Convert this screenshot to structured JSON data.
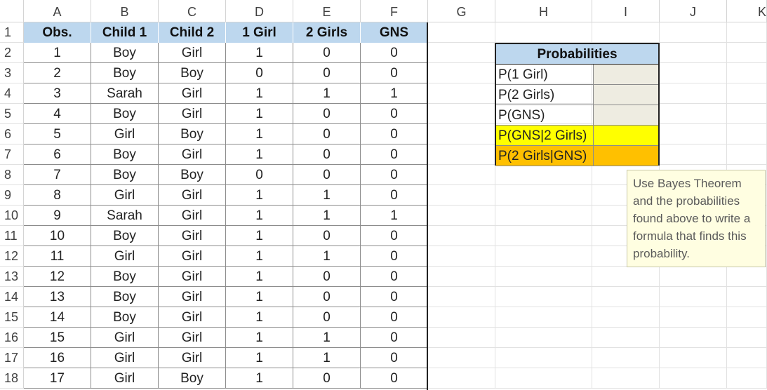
{
  "columns": [
    "A",
    "B",
    "C",
    "D",
    "E",
    "F",
    "G",
    "H",
    "I",
    "J",
    "K"
  ],
  "rows": [
    "1",
    "2",
    "3",
    "4",
    "5",
    "6",
    "7",
    "8",
    "9",
    "10",
    "11",
    "12",
    "13",
    "14",
    "15",
    "16",
    "17",
    "18"
  ],
  "table": {
    "headers": [
      "Obs.",
      "Child 1",
      "Child 2",
      "1 Girl",
      "2 Girls",
      "GNS"
    ],
    "data": [
      [
        "1",
        "Boy",
        "Girl",
        "1",
        "0",
        "0"
      ],
      [
        "2",
        "Boy",
        "Boy",
        "0",
        "0",
        "0"
      ],
      [
        "3",
        "Sarah",
        "Girl",
        "1",
        "1",
        "1"
      ],
      [
        "4",
        "Boy",
        "Girl",
        "1",
        "0",
        "0"
      ],
      [
        "5",
        "Girl",
        "Boy",
        "1",
        "0",
        "0"
      ],
      [
        "6",
        "Boy",
        "Girl",
        "1",
        "0",
        "0"
      ],
      [
        "7",
        "Boy",
        "Boy",
        "0",
        "0",
        "0"
      ],
      [
        "8",
        "Girl",
        "Girl",
        "1",
        "1",
        "0"
      ],
      [
        "9",
        "Sarah",
        "Girl",
        "1",
        "1",
        "1"
      ],
      [
        "10",
        "Boy",
        "Girl",
        "1",
        "0",
        "0"
      ],
      [
        "11",
        "Girl",
        "Girl",
        "1",
        "1",
        "0"
      ],
      [
        "12",
        "Boy",
        "Girl",
        "1",
        "0",
        "0"
      ],
      [
        "13",
        "Boy",
        "Girl",
        "1",
        "0",
        "0"
      ],
      [
        "14",
        "Boy",
        "Girl",
        "1",
        "0",
        "0"
      ],
      [
        "15",
        "Girl",
        "Girl",
        "1",
        "1",
        "0"
      ],
      [
        "16",
        "Girl",
        "Girl",
        "1",
        "1",
        "0"
      ],
      [
        "17",
        "Girl",
        "Boy",
        "1",
        "0",
        "0"
      ]
    ]
  },
  "probabilities": {
    "title": "Probabilities",
    "items": [
      {
        "label": "P(1 Girl)",
        "value": "",
        "color": "#eeece1"
      },
      {
        "label": "P(2 Girls)",
        "value": "",
        "color": "#eeece1"
      },
      {
        "label": "P(GNS)",
        "value": "",
        "color": "#eeece1"
      },
      {
        "label": "P(GNS|2 Girls)",
        "value": "",
        "color": "#ffff00"
      },
      {
        "label": "P(2 Girls|GNS)",
        "value": "",
        "color": "#ffc000"
      }
    ]
  },
  "note": {
    "text": "Use Bayes Theorem and the probabilities found above to write a formula that finds this probability."
  },
  "colors": {
    "header_fill": "#bdd7ee",
    "yellow": "#ffff00",
    "orange": "#ffc000",
    "note_bg": "#fffee1"
  }
}
